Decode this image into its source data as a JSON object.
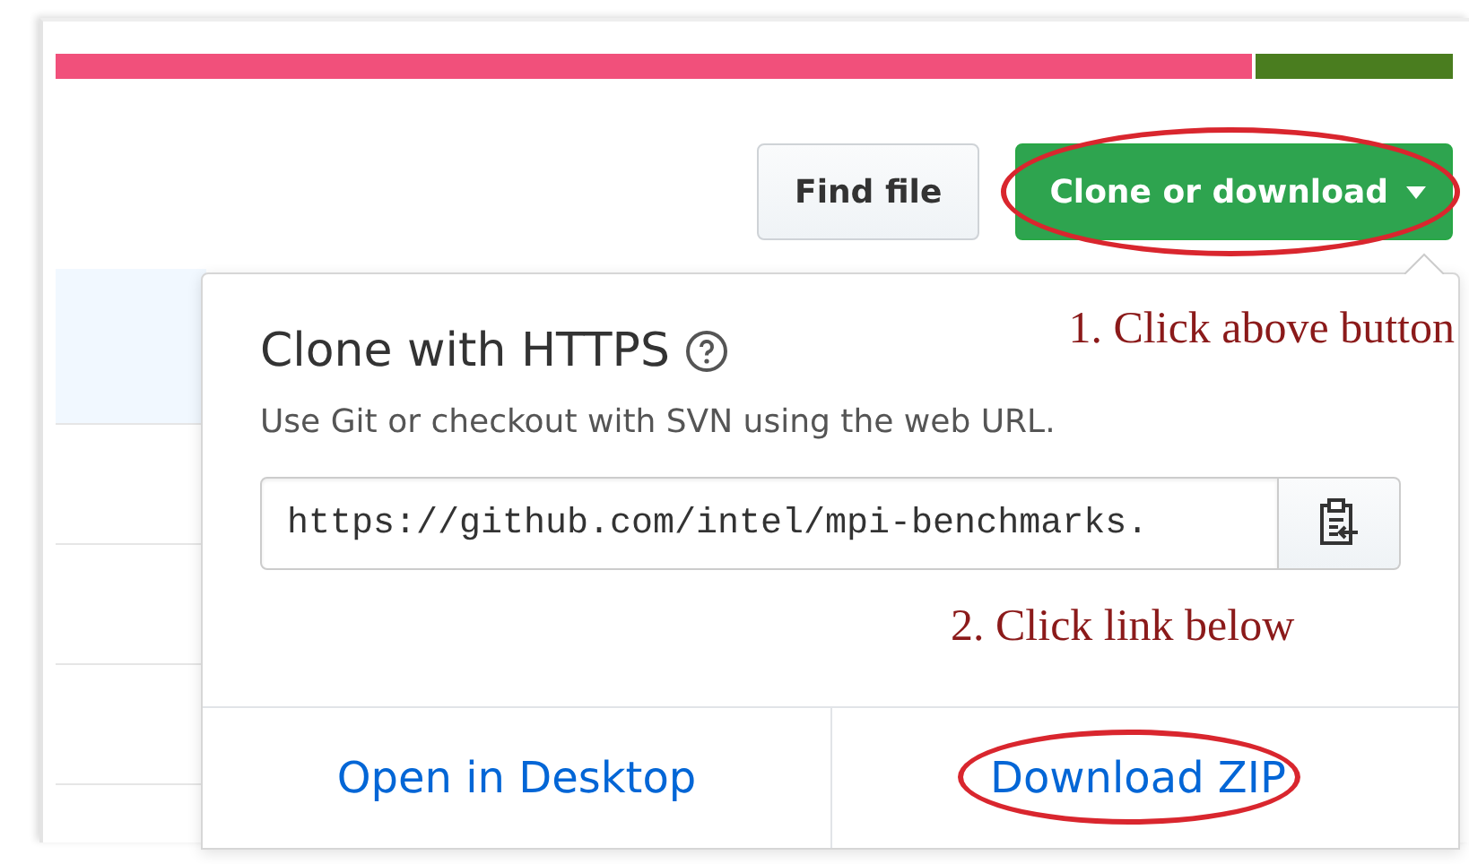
{
  "language_bar": [
    {
      "color": "#f1507b"
    },
    {
      "color": "#4a7d1f"
    }
  ],
  "buttons": [
    {
      "label": "Find file",
      "kind": "plain",
      "highlighted": false
    },
    {
      "label": "Clone or download",
      "kind": "primary",
      "highlighted": true
    }
  ],
  "popover": {
    "title": "Clone with HTTPS",
    "subtitle": "Use Git or checkout with SVN using the web URL.",
    "url": {
      "value": "https://github.com/intel/mpi-benchmarks."
    },
    "links": [
      {
        "label": "Open in Desktop",
        "highlighted": false
      },
      {
        "label": "Download ZIP",
        "highlighted": true
      }
    ]
  },
  "annotations": [
    "1. Click above button",
    "2. Click link below"
  ]
}
